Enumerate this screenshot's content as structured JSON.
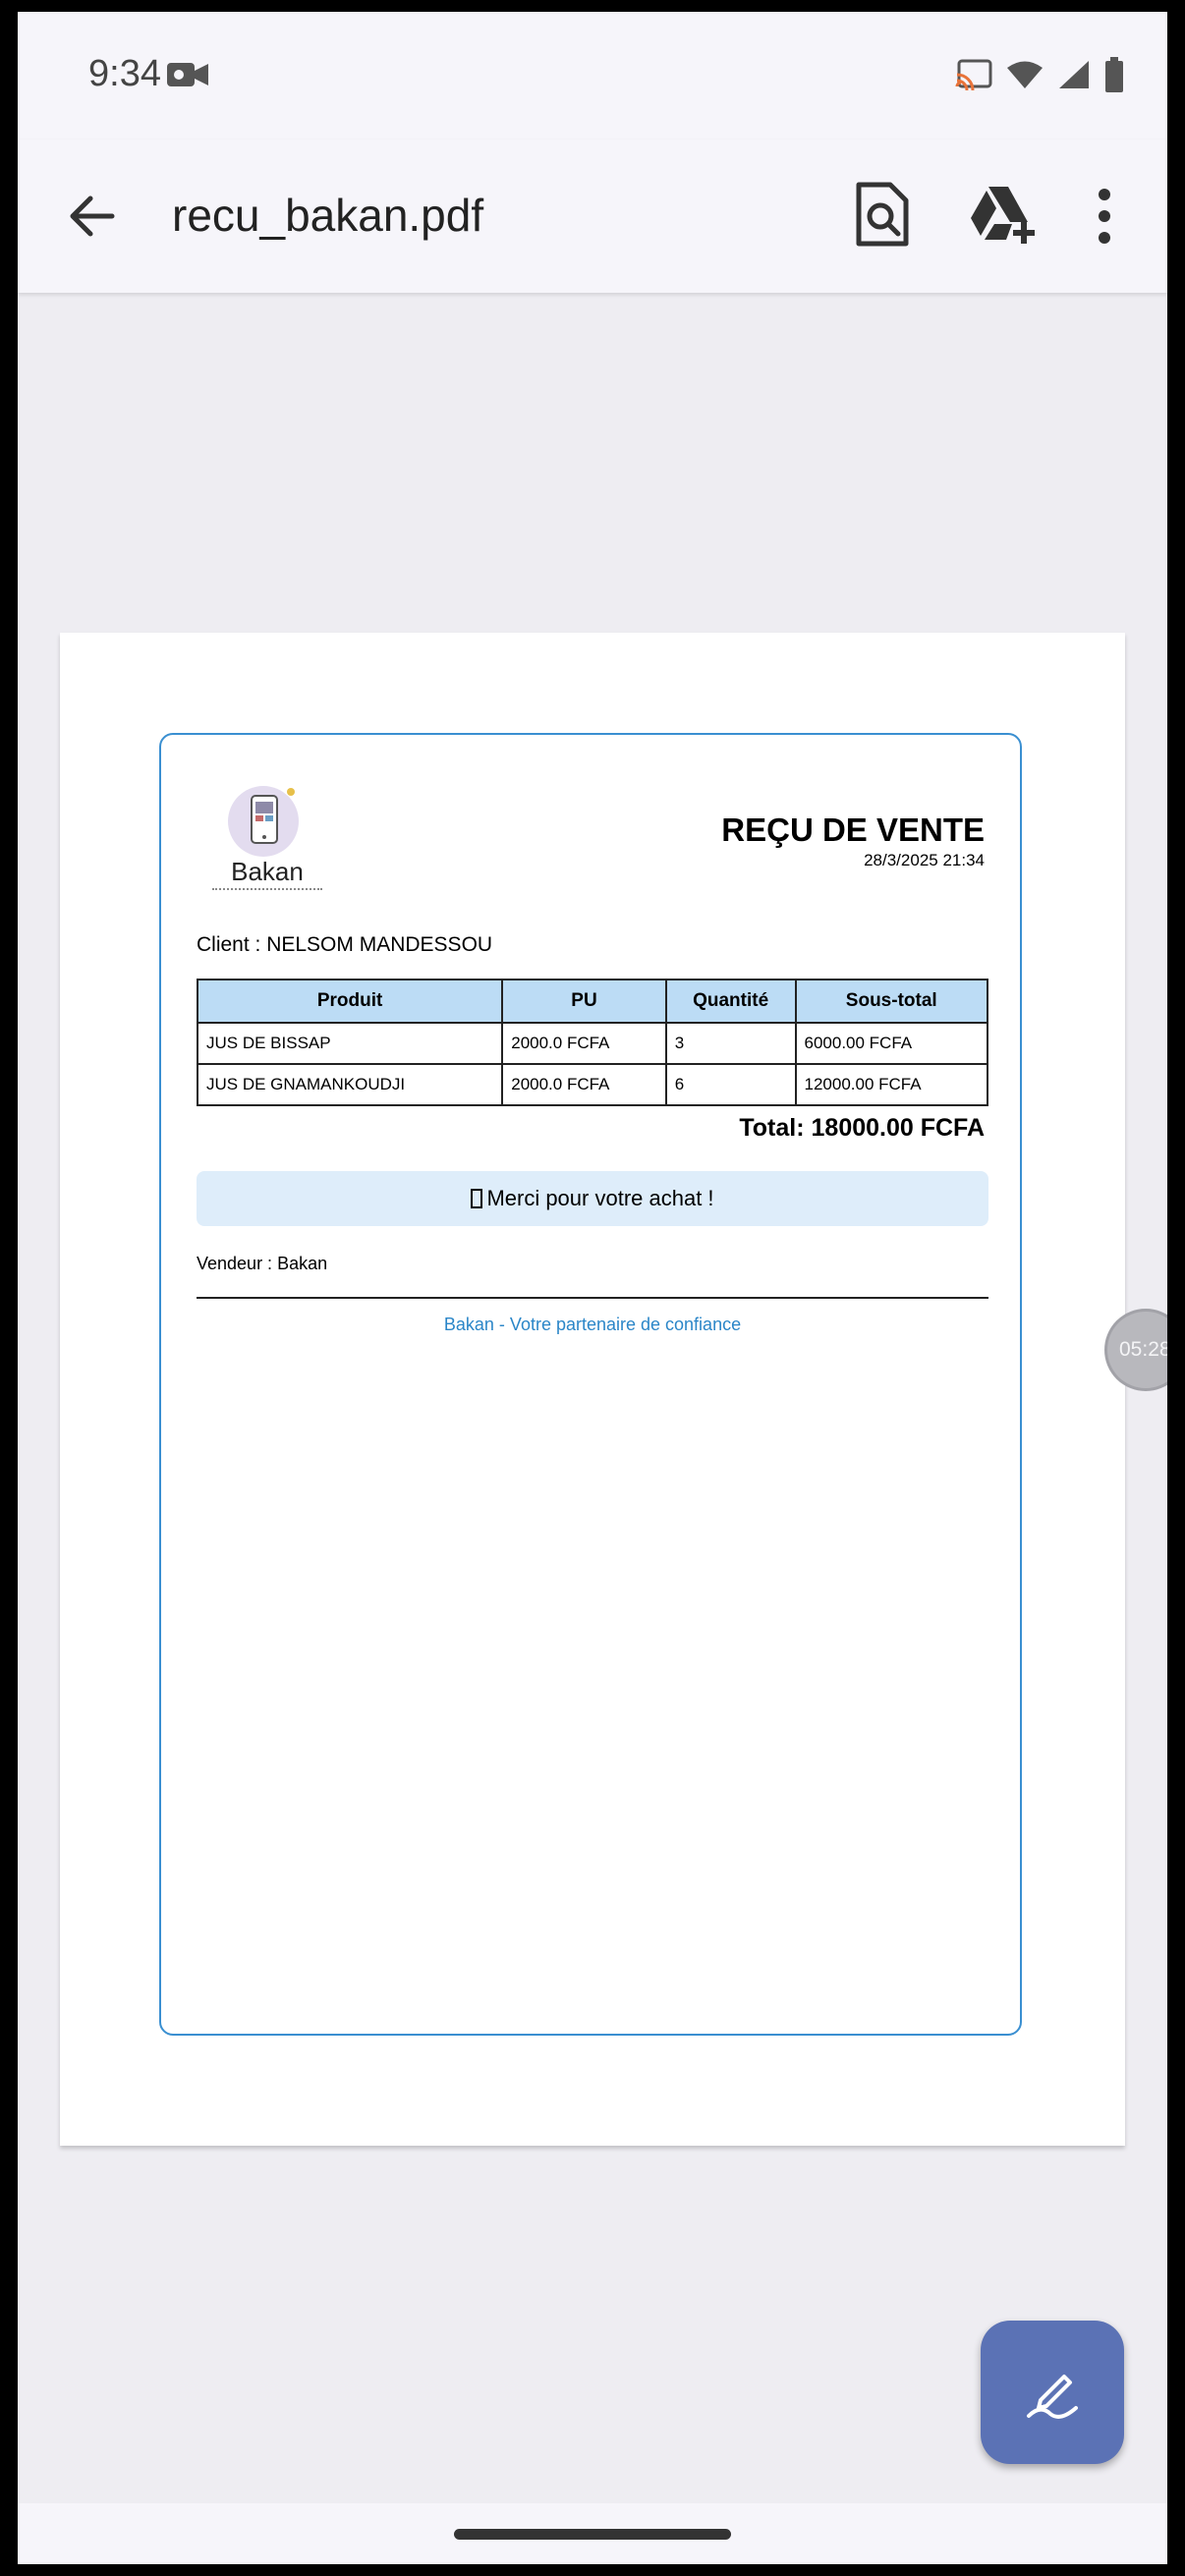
{
  "status_bar": {
    "time": "9:34"
  },
  "app_bar": {
    "title": "recu_bakan.pdf"
  },
  "receipt": {
    "logo_text": "Bakan",
    "title": "REÇU DE VENTE",
    "datetime": "28/3/2025 21:34",
    "client": "Client : NELSOM MANDESSOU",
    "columns": [
      "Produit",
      "PU",
      "Quantité",
      "Sous-total"
    ],
    "rows": [
      {
        "produit": "JUS DE BISSAP",
        "pu": "2000.0 FCFA",
        "quantite": "3",
        "sous_total": "6000.00 FCFA"
      },
      {
        "produit": "JUS DE GNAMANKOUDJI",
        "pu": "2000.0 FCFA",
        "quantite": "6",
        "sous_total": "12000.00 FCFA"
      }
    ],
    "total": "Total: 18000.00 FCFA",
    "thanks": "Merci pour votre achat !",
    "vendor": "Vendeur : Bakan",
    "footer": "Bakan - Votre partenaire de confiance"
  },
  "overlay_timer": "05:28",
  "colors": {
    "accent_border": "#3a8fd1",
    "table_header": "#bcdcf5",
    "thanks_bg": "#deedfa",
    "footer_text": "#2b86c8",
    "fab": "#5b72b5"
  }
}
